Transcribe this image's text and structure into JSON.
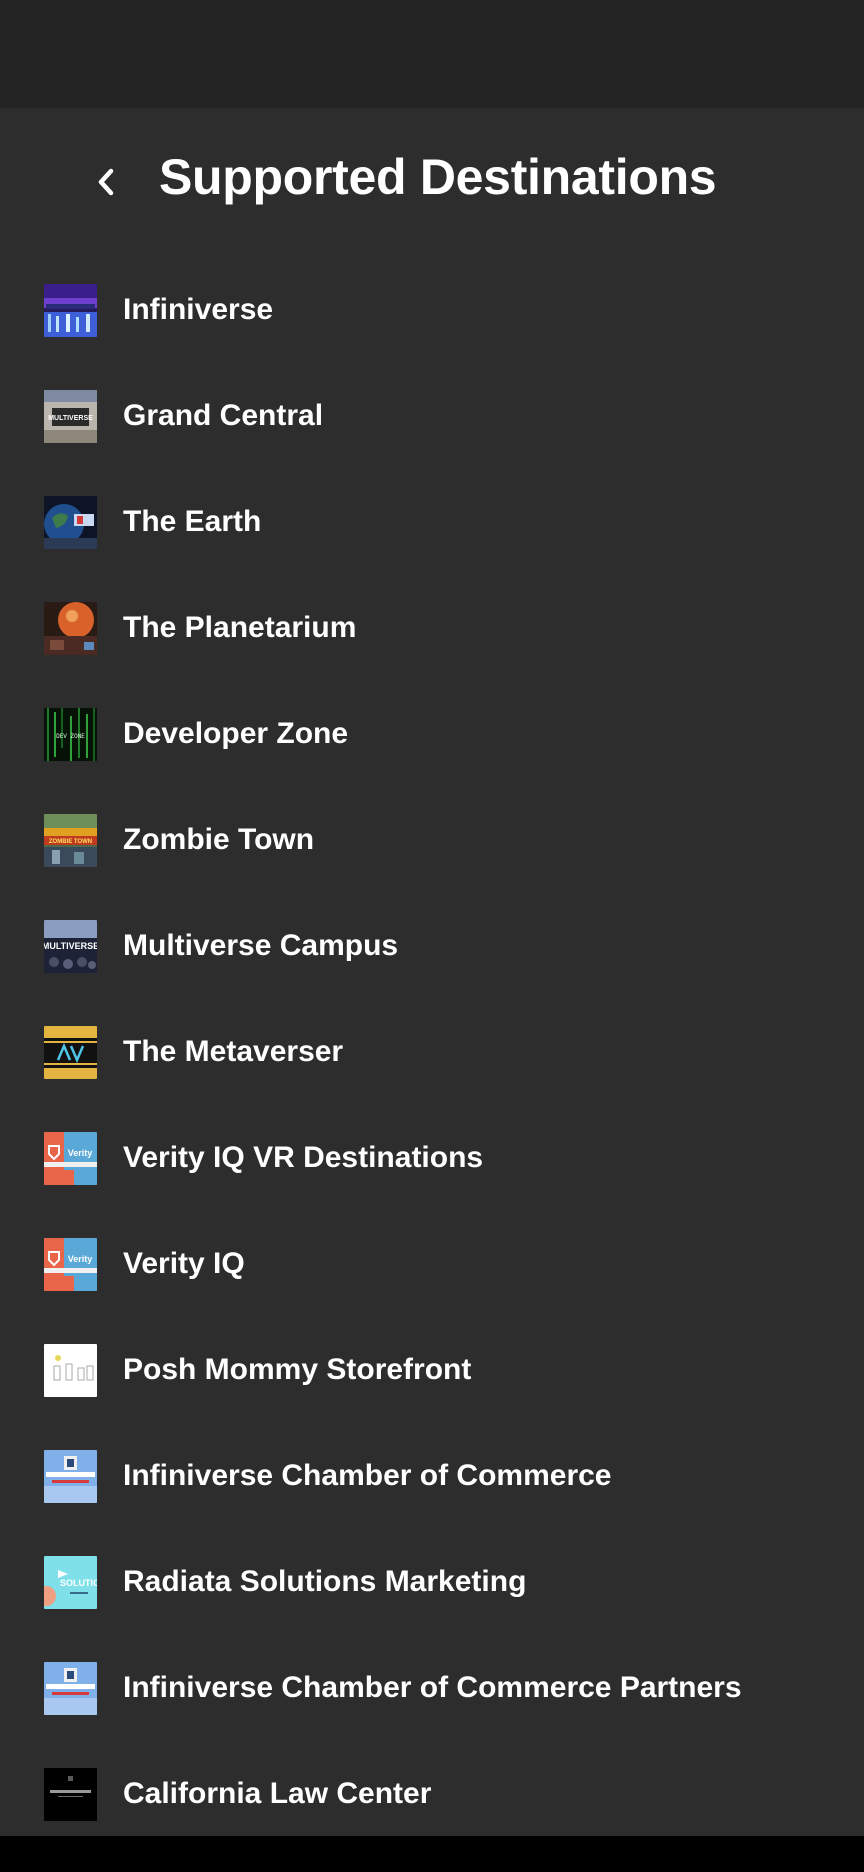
{
  "header": {
    "back_icon": "chevron-left-icon",
    "title": "Supported Destinations"
  },
  "destinations": [
    {
      "label": "Infiniverse",
      "thumb_text": "",
      "icon": "infiniverse-thumbnail"
    },
    {
      "label": "Grand Central",
      "thumb_text": "MULTIVERSE",
      "icon": "grand-central-thumbnail"
    },
    {
      "label": "The Earth",
      "thumb_text": "",
      "icon": "earth-thumbnail"
    },
    {
      "label": "The Planetarium",
      "thumb_text": "",
      "icon": "planetarium-thumbnail"
    },
    {
      "label": "Developer Zone",
      "thumb_text": "DEV ZONE",
      "icon": "developer-zone-thumbnail"
    },
    {
      "label": "Zombie Town",
      "thumb_text": "ZOMBIE TOWN",
      "icon": "zombie-town-thumbnail"
    },
    {
      "label": "Multiverse Campus",
      "thumb_text": "MULTIVERSE",
      "icon": "multiverse-campus-thumbnail"
    },
    {
      "label": "The Metaverser",
      "thumb_text": "",
      "icon": "metaverser-thumbnail"
    },
    {
      "label": "Verity IQ VR Destinations",
      "thumb_text": "Verity",
      "icon": "verity-iq-vr-thumbnail"
    },
    {
      "label": "Verity IQ",
      "thumb_text": "Verity",
      "icon": "verity-iq-thumbnail"
    },
    {
      "label": "Posh Mommy Storefront",
      "thumb_text": "",
      "icon": "posh-mommy-thumbnail"
    },
    {
      "label": "Infiniverse Chamber of Commerce",
      "thumb_text": "",
      "icon": "chamber-of-commerce-thumbnail"
    },
    {
      "label": "Radiata Solutions Marketing",
      "thumb_text": "SOLUTIO",
      "icon": "radiata-thumbnail"
    },
    {
      "label": "Infiniverse Chamber of Commerce Partners",
      "thumb_text": "",
      "icon": "chamber-partners-thumbnail"
    },
    {
      "label": "California Law Center",
      "thumb_text": "",
      "icon": "california-law-thumbnail"
    }
  ],
  "colors": {
    "background": "#2d2d2d",
    "status_bar": "#242424",
    "text": "#ffffff"
  }
}
